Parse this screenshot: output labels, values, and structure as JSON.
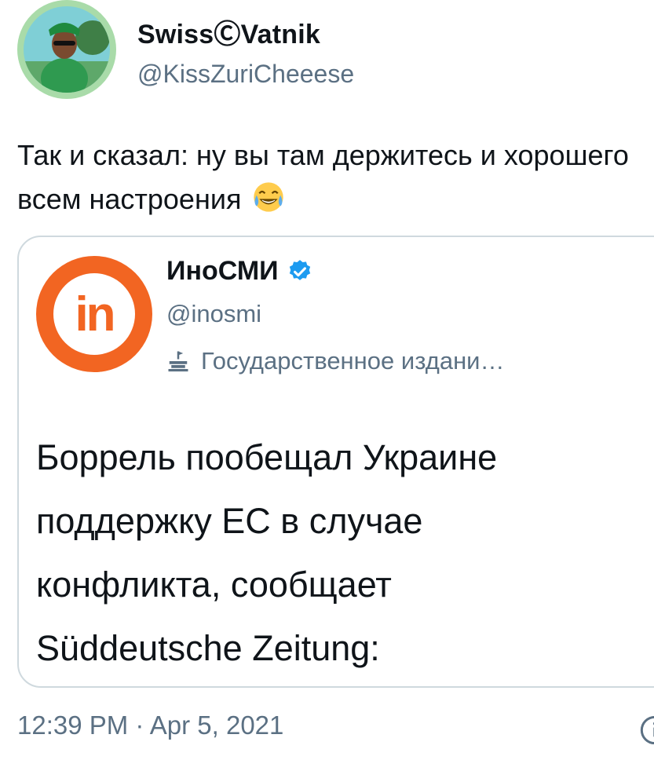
{
  "author": {
    "display_name": "SwissⒸVatnik",
    "handle": "@KissZuriCheeese"
  },
  "tweet": {
    "text": "Так и сказал: ну вы там держитесь и хорошего всем настроения",
    "emoji": "face-with-tears-of-joy-icon"
  },
  "quoted_tweet": {
    "display_name": "ИноСМИ",
    "handle": "@inosmi",
    "label": "Государственное издани…",
    "text_lines": [
      "Боррель пообещал Украине",
      "поддержку ЕС в случае",
      "конфликта, сообщает",
      "Süddeutsche Zeitung:"
    ]
  },
  "meta": {
    "timestamp": "12:39 PM · Apr 5, 2021"
  },
  "colors": {
    "accent": "#1d9bf0",
    "secondary_text": "#5b7083",
    "border": "#cfd9de",
    "brand_orange": "#f26522"
  }
}
